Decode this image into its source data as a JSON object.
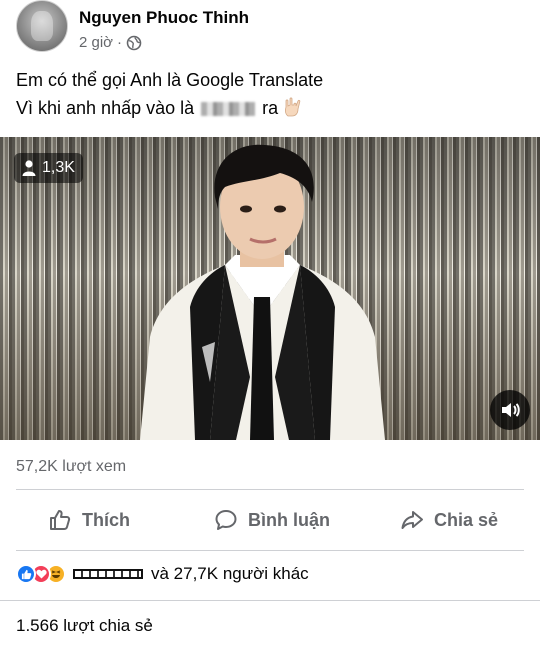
{
  "post": {
    "author": "Nguyen Phuoc Thinh",
    "time": "2 giờ",
    "separator": "·",
    "text_line1": "Em có thể gọi Anh là Google Translate",
    "text_line2_before": "Vì khi anh nhấp vào là",
    "text_line2_after": "ra"
  },
  "video": {
    "viewer_count": "1,3K",
    "views_label": "57,2K lượt xem"
  },
  "actions": {
    "like": "Thích",
    "comment": "Bình luận",
    "share": "Chia sẻ"
  },
  "reactions": {
    "summary": "và 27,7K người khác",
    "types": [
      "like-icon",
      "love-icon",
      "haha-icon"
    ]
  },
  "shares": {
    "label": "1.566 lượt chia sẻ"
  },
  "colors": {
    "facebook_blue": "#1877f2",
    "secondary_text": "#65676b",
    "love_red": "#f33e58",
    "haha_yellow": "#f7b125"
  }
}
